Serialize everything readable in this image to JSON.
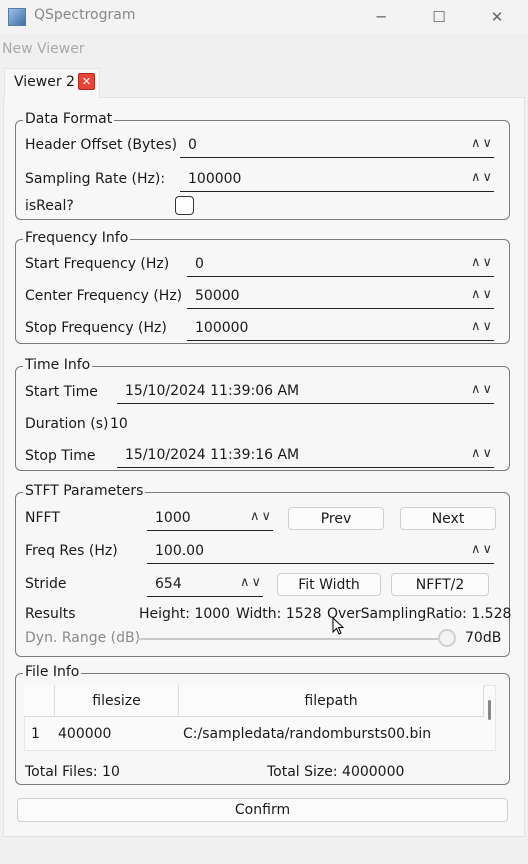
{
  "window": {
    "title": "QSpectrogram",
    "min_icon": "─",
    "max_icon": "☐",
    "close_icon": "✕"
  },
  "menu": {
    "new_viewer": "New Viewer"
  },
  "tab": {
    "label": "Viewer 2",
    "close": "✕"
  },
  "spin_glyph": "∧∨",
  "data_format": {
    "title": "Data Format",
    "header_offset_label": "Header Offset (Bytes)",
    "header_offset_value": "0",
    "sampling_rate_label": "Sampling Rate (Hz):",
    "sampling_rate_value": "100000",
    "is_real_label": "isReal?"
  },
  "frequency_info": {
    "title": "Frequency Info",
    "start_label": "Start Frequency (Hz)",
    "start_value": "0",
    "center_label": "Center Frequency (Hz)",
    "center_value": "50000",
    "stop_label": "Stop Frequency (Hz)",
    "stop_value": "100000"
  },
  "time_info": {
    "title": "Time Info",
    "start_label": "Start Time",
    "start_value": "15/10/2024 11:39:06 AM",
    "duration_label": "Duration (s)",
    "duration_value": "10",
    "stop_label": "Stop Time",
    "stop_value": "15/10/2024 11:39:16 AM"
  },
  "stft": {
    "title": "STFT Parameters",
    "nfft_label": "NFFT",
    "nfft_value": "1000",
    "prev_label": "Prev",
    "next_label": "Next",
    "freq_res_label": "Freq Res (Hz)",
    "freq_res_value": "100.00",
    "stride_label": "Stride",
    "stride_value": "654",
    "fit_width_label": "Fit Width",
    "nfft_half_label": "NFFT/2",
    "results_label": "Results",
    "height_text": "Height: 1000",
    "width_text": "Width: 1528",
    "oversampling_text": "OverSamplingRatio: 1.528",
    "dyn_range_label": "Dyn. Range (dB)",
    "dyn_range_value": "70dB",
    "dyn_range_fraction": 0.98
  },
  "file_info": {
    "title": "File Info",
    "columns": [
      "filesize",
      "filepath"
    ],
    "rows": [
      {
        "index": "1",
        "filesize": "400000",
        "filepath": "C:/sampledata/randombursts00.bin"
      }
    ],
    "total_files": "Total Files: 10",
    "total_size": "Total Size: 4000000"
  },
  "confirm_label": "Confirm"
}
